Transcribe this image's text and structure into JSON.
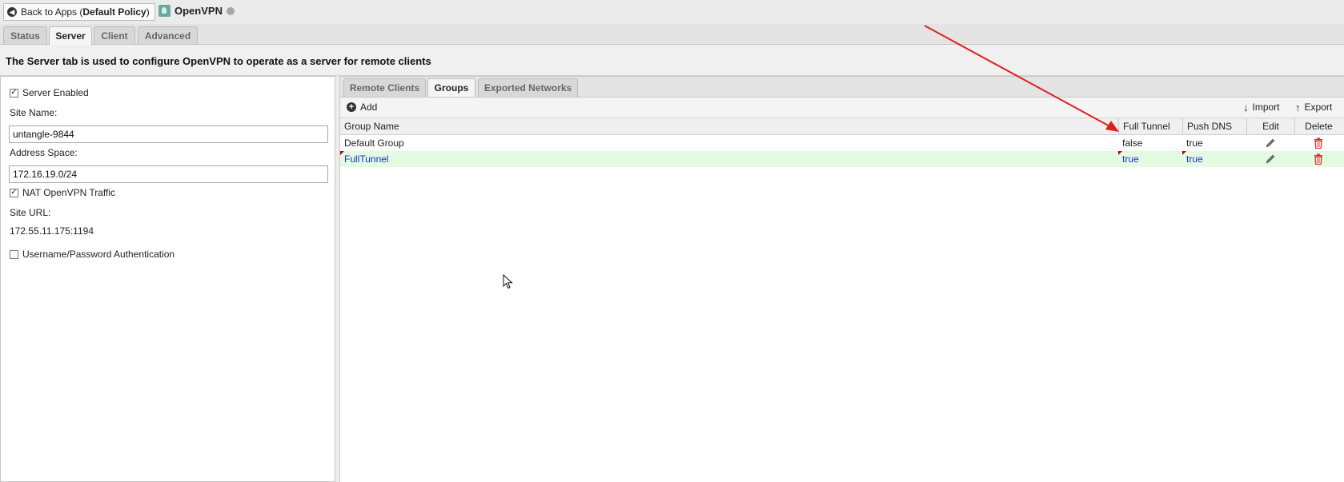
{
  "header": {
    "back_prefix": "Back to Apps (",
    "back_policy": "Default Policy",
    "back_suffix": ")",
    "app_name": "OpenVPN"
  },
  "main_tabs": [
    {
      "label": "Status",
      "active": false
    },
    {
      "label": "Server",
      "active": true
    },
    {
      "label": "Client",
      "active": false
    },
    {
      "label": "Advanced",
      "active": false
    }
  ],
  "description": "The Server tab is used to configure OpenVPN to operate as a server for remote clients",
  "server_form": {
    "server_enabled_label": "Server Enabled",
    "server_enabled": true,
    "site_name_label": "Site Name:",
    "site_name_value": "untangle-9844",
    "address_space_label": "Address Space:",
    "address_space_value": "172.16.19.0/24",
    "nat_label": "NAT OpenVPN Traffic",
    "nat_enabled": true,
    "site_url_label": "Site URL:",
    "site_url_value": "172.55.11.175:1194",
    "auth_label": "Username/Password Authentication",
    "auth_enabled": false
  },
  "sub_tabs": [
    {
      "label": "Remote Clients",
      "active": false
    },
    {
      "label": "Groups",
      "active": true
    },
    {
      "label": "Exported Networks",
      "active": false
    }
  ],
  "toolbar": {
    "add_label": "Add",
    "import_label": "Import",
    "export_label": "Export"
  },
  "grid": {
    "columns": [
      "Group Name",
      "Full Tunnel",
      "Push DNS",
      "Edit",
      "Delete"
    ],
    "rows": [
      {
        "name": "Default Group",
        "full_tunnel": "false",
        "push_dns": "true",
        "dirty": false
      },
      {
        "name": "FullTunnel",
        "full_tunnel": "true",
        "push_dns": "true",
        "dirty": true
      }
    ]
  },
  "colors": {
    "dirty_row": "#e3fbe3",
    "dirty_text": "#1a2fd0",
    "annotation_arrow": "#e02020",
    "delete_icon": "#e03030"
  }
}
